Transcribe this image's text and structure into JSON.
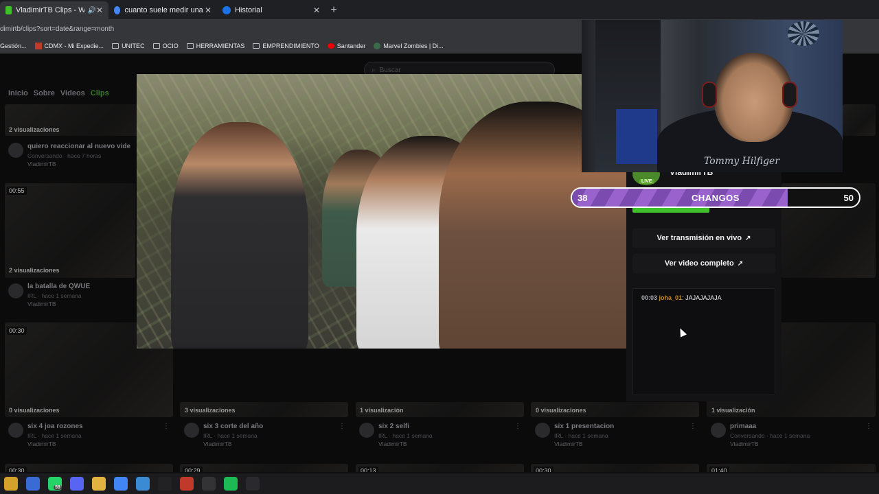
{
  "browser": {
    "tabs": [
      {
        "title": "VladimirTB Clips - Watch Li",
        "favicon_color": "#3fbf2a"
      },
      {
        "title": "cuanto suele medir una piedra",
        "favicon_color": "#4285f4"
      },
      {
        "title": "Historial",
        "favicon_color": "#1a73e8"
      }
    ],
    "url": "dimirtb/clips?sort=date&range=month",
    "bookmarks": [
      {
        "label": "Gestión...",
        "icon": "none"
      },
      {
        "label": "CDMX - Mi Expedie...",
        "icon": "site-icon"
      },
      {
        "label": "UNITEC",
        "icon": "folder-icon"
      },
      {
        "label": "OCIO",
        "icon": "folder-icon"
      },
      {
        "label": "HERRAMIENTAS",
        "icon": "folder-icon"
      },
      {
        "label": "EMPRENDIMIENTO",
        "icon": "folder-icon"
      },
      {
        "label": "Santander",
        "icon": "santander-icon"
      },
      {
        "label": "Marvel Zombies | Di...",
        "icon": "site-icon"
      }
    ]
  },
  "site": {
    "search_placeholder": "Buscar",
    "nav": [
      "Inicio",
      "Sobre",
      "Videos",
      "Clips"
    ],
    "active_nav": "Clips"
  },
  "clips_row1": [
    {
      "views": "2 visualizaciones",
      "title": "quiero reaccionar al nuevo vide",
      "category": "Conversando · hace 7 horas",
      "channel": "VladimirTB"
    }
  ],
  "clips_row2": [
    {
      "duration": "00:55",
      "views": "2 visualizaciones",
      "title": "la batalla de QWUE",
      "category": "IRL · hace 1 semana",
      "channel": "VladimirTB"
    }
  ],
  "clips_row3": [
    {
      "duration": "00:30",
      "views": "0 visualizaciones",
      "title": "six 4 joa rozones",
      "category": "IRL · hace 1 semana",
      "channel": "VladimirTB"
    },
    {
      "duration": "",
      "views": "3 visualizaciones",
      "title": "six 3 corte del año",
      "category": "IRL · hace 1 semana",
      "channel": "VladimirTB"
    },
    {
      "duration": "",
      "views": "1 visualización",
      "title": "six 2 selfi",
      "category": "IRL · hace 1 semana",
      "channel": "VladimirTB"
    },
    {
      "duration": "",
      "views": "0 visualizaciones",
      "title": "six 1 presentacion",
      "category": "IRL · hace 1 semana",
      "channel": "VladimirTB"
    },
    {
      "duration": "",
      "views": "1 visualización",
      "title": "primaaa",
      "category": "Conversando · hace 1 semana",
      "channel": "VladimirTB"
    }
  ],
  "clips_row4_durations": [
    "00:30",
    "00:29",
    "00:13",
    "00:30",
    "01:40"
  ],
  "streamer": {
    "name": "VladimirTB",
    "live_label": "LIVE"
  },
  "side_buttons": {
    "live": "Ver transmisión en vivo",
    "full": "Ver video completo"
  },
  "chat": {
    "messages": [
      {
        "time": "00:03",
        "user": "joha_01",
        "text": "JAJAJAJAJA"
      }
    ]
  },
  "poll": {
    "left_value": "38",
    "label": "CHANGOS",
    "right_value": "50",
    "fill_fraction": 0.75
  },
  "overlay": {
    "brand": "Tommy Hilfiger"
  },
  "taskbar": {
    "items": [
      {
        "name": "copilot-icon",
        "color": "#d4a12a"
      },
      {
        "name": "chrome-icon",
        "color": "#3a6ad4"
      },
      {
        "name": "whatsapp-icon",
        "color": "#25d366",
        "badge": "59"
      },
      {
        "name": "discord-icon",
        "color": "#5865f2"
      },
      {
        "name": "files-icon",
        "color": "#e3b341"
      },
      {
        "name": "chrome-active-icon",
        "color": "#4285f4"
      },
      {
        "name": "edge-icon",
        "color": "#3a8ad4"
      },
      {
        "name": "capcut-icon",
        "color": "#222"
      },
      {
        "name": "app-red-icon",
        "color": "#c0392b"
      },
      {
        "name": "obs-icon",
        "color": "#333"
      },
      {
        "name": "spotify-icon",
        "color": "#1db954"
      },
      {
        "name": "terminal-icon",
        "color": "#2a2a2e"
      }
    ]
  }
}
